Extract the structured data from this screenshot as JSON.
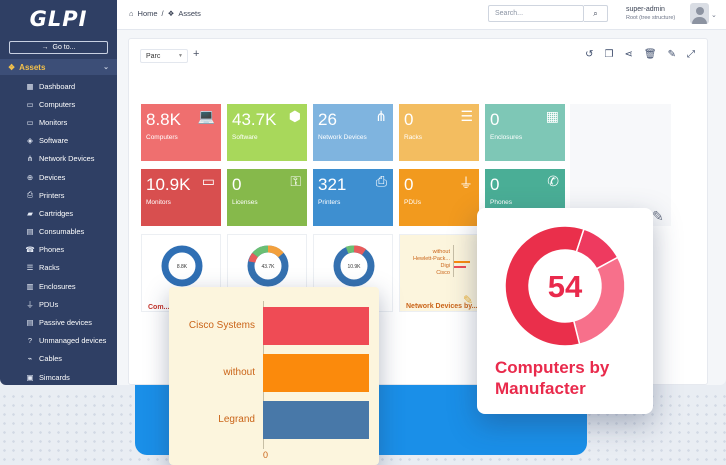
{
  "app": {
    "logo": "GLPI"
  },
  "sidebar": {
    "goto_label": "Go to...",
    "section": {
      "label": "Assets",
      "icon": "cubes-icon"
    },
    "items": [
      {
        "label": "Dashboard",
        "icon": "dashboard-icon"
      },
      {
        "label": "Computers",
        "icon": "computer-icon"
      },
      {
        "label": "Monitors",
        "icon": "monitor-icon"
      },
      {
        "label": "Software",
        "icon": "software-icon"
      },
      {
        "label": "Network Devices",
        "icon": "network-icon"
      },
      {
        "label": "Devices",
        "icon": "device-icon"
      },
      {
        "label": "Printers",
        "icon": "printer-icon"
      },
      {
        "label": "Cartridges",
        "icon": "cartridge-icon"
      },
      {
        "label": "Consumables",
        "icon": "consumable-icon"
      },
      {
        "label": "Phones",
        "icon": "phone-icon"
      },
      {
        "label": "Racks",
        "icon": "rack-icon"
      },
      {
        "label": "Enclosures",
        "icon": "enclosure-icon"
      },
      {
        "label": "PDUs",
        "icon": "plug-icon"
      },
      {
        "label": "Passive devices",
        "icon": "passive-icon"
      },
      {
        "label": "Unmanaged devices",
        "icon": "question-icon"
      },
      {
        "label": "Cables",
        "icon": "cable-icon"
      },
      {
        "label": "Simcards",
        "icon": "simcard-icon"
      }
    ]
  },
  "header": {
    "breadcrumb": [
      "Home",
      "Assets"
    ],
    "search_placeholder": "Search...",
    "user": {
      "name": "super-admin",
      "entity": "Root (tree structure)"
    }
  },
  "dashboard": {
    "selected": "Parc",
    "tiles": [
      {
        "value": "8.8K",
        "label": "Computers",
        "color": "#ef6f6f",
        "icon": "laptop-icon"
      },
      {
        "value": "43.7K",
        "label": "Software",
        "color": "#a8d85b",
        "icon": "box-icon"
      },
      {
        "value": "26",
        "label": "Network Devices",
        "color": "#7fb4df",
        "icon": "network-icon"
      },
      {
        "value": "0",
        "label": "Racks",
        "color": "#f3bd60",
        "icon": "rack-icon"
      },
      {
        "value": "0",
        "label": "Enclosures",
        "color": "#7ec7b6",
        "icon": "grid-icon"
      },
      {
        "value": "10.9K",
        "label": "Monitors",
        "color": "#d84f4f",
        "icon": "monitor-icon"
      },
      {
        "value": "0",
        "label": "Licenses",
        "color": "#86b94b",
        "icon": "key-icon"
      },
      {
        "value": "321",
        "label": "Printers",
        "color": "#3e8fd0",
        "icon": "printer-icon"
      },
      {
        "value": "0",
        "label": "PDUs",
        "color": "#f29a1e",
        "icon": "plug-icon"
      },
      {
        "value": "0",
        "label": "Phones",
        "color": "#4aae96",
        "icon": "phone-icon"
      }
    ],
    "mini_widgets": [
      {
        "center": "8.8K",
        "label": "Com... by S..."
      },
      {
        "center": "43.7K"
      },
      {
        "center": "10.9K"
      },
      {
        "label": "Network Devices by...",
        "legend": [
          "without",
          "Hewlett-Pack...",
          "Digi",
          "Cisco"
        ]
      }
    ]
  },
  "chart_data": [
    {
      "type": "bar",
      "categories": [
        "Cisco Systems",
        "without",
        "Legrand"
      ],
      "values": [
        24,
        24,
        24
      ],
      "colors": [
        "#ef4b55",
        "#fb8a0c",
        "#4878a8"
      ],
      "tick_labels": [
        "0"
      ],
      "grid": false
    },
    {
      "type": "pie",
      "title": "Computers by Manufacter",
      "center_label": "54",
      "categories": [
        "slice-a",
        "slice-b",
        "slice-c"
      ],
      "values": [
        12,
        29,
        59
      ],
      "colors": [
        "#ee3a5f",
        "#f7708b",
        "#ea2f4b"
      ]
    }
  ]
}
